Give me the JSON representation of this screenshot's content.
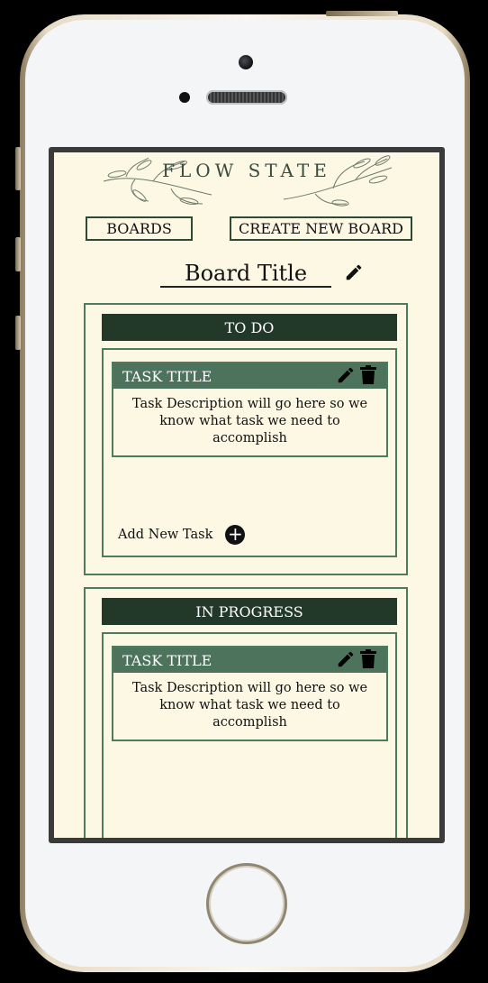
{
  "app": {
    "brand": "FLOW STATE"
  },
  "nav": {
    "boards_label": "BOARDS",
    "create_label": "CREATE NEW BOARD"
  },
  "board": {
    "title": "Board Title"
  },
  "columns": [
    {
      "title": "TO DO",
      "tasks": [
        {
          "title": "TASK TITLE",
          "description": "Task Description will go here so we know what task we need to accomplish"
        }
      ],
      "add_task_label": "Add New Task"
    },
    {
      "title": "IN PROGRESS",
      "tasks": [
        {
          "title": "TASK TITLE",
          "description": "Task Description will go here so we know what task we need to accomplish"
        }
      ]
    }
  ],
  "icons": {
    "edit": "pencil-icon",
    "delete": "trash-icon",
    "add": "plus-circle-icon"
  },
  "colors": {
    "background": "#fcf8e3",
    "header_dark": "#22392a",
    "task_header": "#4d735d",
    "border": "#4f7a5e"
  }
}
